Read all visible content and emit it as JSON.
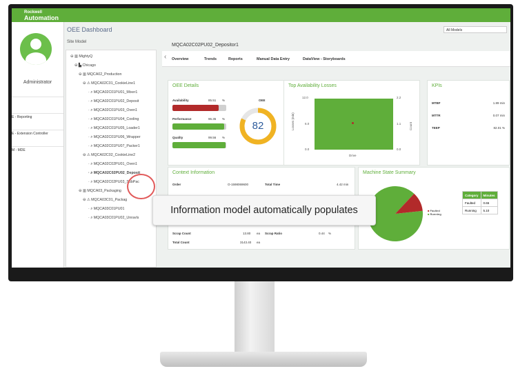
{
  "app": {
    "logo_line1": "Rockwell",
    "logo_line2": "Automation",
    "title": "OEE Dashboard",
    "model_select": "All Models",
    "breadcrumb": "MQCA02C02PU02_Depositor1",
    "site_model_label": "Site Model"
  },
  "sidebar": {
    "user": "Administrator",
    "items": [
      "E - Reporting",
      "E - Extension Controller",
      "M - MDE"
    ]
  },
  "tree": [
    "MightyQ",
    "Chicago",
    "MQCA02_Production",
    "MQCA02C01_CookieLine1",
    "MQCA02C01PU01_Mixer1",
    "MQCA02C01PU02_Deposit",
    "MQCA02C01PU03_Oven1",
    "MQCA02C01PU04_Cooling",
    "MQCA02C01PU05_Loader1",
    "MQCA02C01PU06_Wrapper",
    "MQCA02C01PU07_Packer1",
    "MQCA02C02_CookieLine2",
    "MQCA02C02PU01_Oven1",
    "MQCA02C02PU02_Deposit",
    "MQCA02C02PU03_SubPac",
    "MQCA03_Packaging",
    "MQCA03C01_Packag",
    "MQCA03C01PU01",
    "MQCA03C01PU02_Unravls"
  ],
  "tabs": [
    "Overview",
    "Trends",
    "Reports",
    "Manual Data Entry",
    "DataView - Storyboards"
  ],
  "oee": {
    "title": "OEE Details",
    "oee_label": "OEE",
    "oee_value": "82",
    "rows": [
      {
        "label": "Availability",
        "value": "85.51",
        "unit": "%",
        "fill": 0.86,
        "color": "#b22a2a"
      },
      {
        "label": "Performance",
        "value": "96.35",
        "unit": "%",
        "fill": 0.96,
        "color": "#5fae3a"
      },
      {
        "label": "Quality",
        "value": "99.56",
        "unit": "%",
        "fill": 0.99,
        "color": "#5fae3a"
      }
    ]
  },
  "losses": {
    "title": "Top Availability Losses",
    "y_left": [
      "12.0",
      "6.0",
      "0.0"
    ],
    "y_right": [
      "2.2",
      "1.1",
      "0.0"
    ],
    "y_left_label": "Losses (min)",
    "y_right_label": "Count",
    "x_label": "Drive"
  },
  "kpis": {
    "title": "KPIs",
    "rows": [
      {
        "label": "MTBF",
        "value": "1.89 min"
      },
      {
        "label": "MTTR",
        "value": "0.07 min"
      },
      {
        "label": "TEEP",
        "value": "82.01 %"
      }
    ]
  },
  "context": {
    "title": "Context Information",
    "order_label": "Order",
    "order_value": "O-1598069600",
    "total_time_label": "Total Time",
    "total_time_value": "4.42 min",
    "good_count_label": "Good Count",
    "good_count_value": "3129.60",
    "scrap_count_label": "Scrap Count",
    "scrap_count_value": "13.80",
    "total_count_label": "Total Count",
    "total_count_value": "3143.40",
    "unit": "ea",
    "good_ratio_label": "Good Ratio",
    "good_ratio_value": "99.56",
    "scrap_ratio_label": "Scrap Ratio",
    "scrap_ratio_value": "0.44",
    "pct": "%"
  },
  "machine_state": {
    "title": "Machine State Summary",
    "legend": [
      "Faulted",
      "Running"
    ],
    "colors": {
      "faulted": "#b22a2a",
      "running": "#5fae3a"
    },
    "table_header": [
      "Category",
      "Minutes"
    ],
    "rows": [
      {
        "category": "Faulted",
        "minutes": "0.65"
      },
      {
        "category": "Running",
        "minutes": "5.10"
      }
    ]
  },
  "callout": "Information model automatically populates"
}
